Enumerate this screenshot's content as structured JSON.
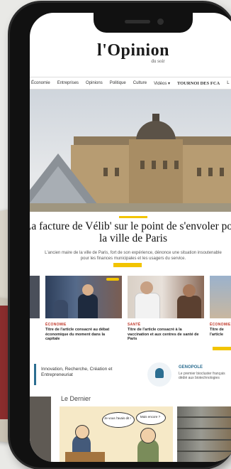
{
  "site": {
    "logo_text": "l'Opinion",
    "logo_sub": "du soir"
  },
  "nav": {
    "items": [
      "Économie",
      "Entreprises",
      "Opinions",
      "Politique",
      "Culture",
      "Vidéos ▾"
    ],
    "highlight": "TOURNOI DES FCA",
    "tail": "L"
  },
  "hero": {
    "headline": "La facture de Vélib' sur le point de s'envoler pour la ville de Paris",
    "lede": "L'ancien maire de la ville de Paris, fort de son expérience, dénonce une situation insoutenable pour les finances municipales et les usagers du service."
  },
  "cards": [
    {
      "tag": "ÉCONOMIE",
      "title": "Titre de l'article consacré au débat économique du moment dans la capitale"
    },
    {
      "tag": "SANTÉ",
      "title": "Titre de l'article consacré à la vaccination et aux centres de santé de Paris"
    },
    {
      "tag": "ÉCONOMIE",
      "title": "Titre de l'article"
    }
  ],
  "partner": {
    "text": "Innovation, Recherche, Création et Entrepreneuriat",
    "name": "GENOPOLE",
    "desc": "Le premier biocluster français dédié aux biotechnologies"
  },
  "section": {
    "title": "Le Dernier"
  },
  "cartoon": {
    "bubble1": "Je vous l'avais dit !",
    "bubble2": "Mais encore ?"
  },
  "colors": {
    "accent": "#f2c400",
    "brand": "#c0392b",
    "partner": "#2c6e91"
  }
}
